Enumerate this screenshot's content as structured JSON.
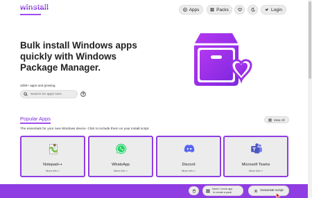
{
  "header": {
    "logo": "winstall",
    "nav": {
      "apps": "Apps",
      "packs": "Packs",
      "login": "Login"
    }
  },
  "hero": {
    "title_lines": [
      "Bulk install Windows apps",
      "quickly with Windows",
      "Package Manager."
    ],
    "subtitle": "1050+ apps and growing.",
    "search_placeholder": "Search for apps here"
  },
  "popular": {
    "title": "Popular Apps",
    "description": "The essentials for your new Windows device. Click to include them on your install script.",
    "view_all": "View All",
    "apps": [
      {
        "name": "Notepad++",
        "more": "More Info »"
      },
      {
        "name": "WhatsApp",
        "more": "More Info »"
      },
      {
        "name": "Discord",
        "more": "More Info »"
      },
      {
        "name": "Microsoft Teams",
        "more": "More Info »"
      }
    ]
  },
  "bottom_bar": {
    "selected_text": "Selected 4 apps so far",
    "pack_line1": "Need 1 more app",
    "pack_line2": "to create a pack",
    "generate": "Generate script"
  },
  "colors": {
    "accent": "#8f3ce3",
    "brand_text": "#7b2bd9",
    "chip_bg": "#ececec"
  }
}
